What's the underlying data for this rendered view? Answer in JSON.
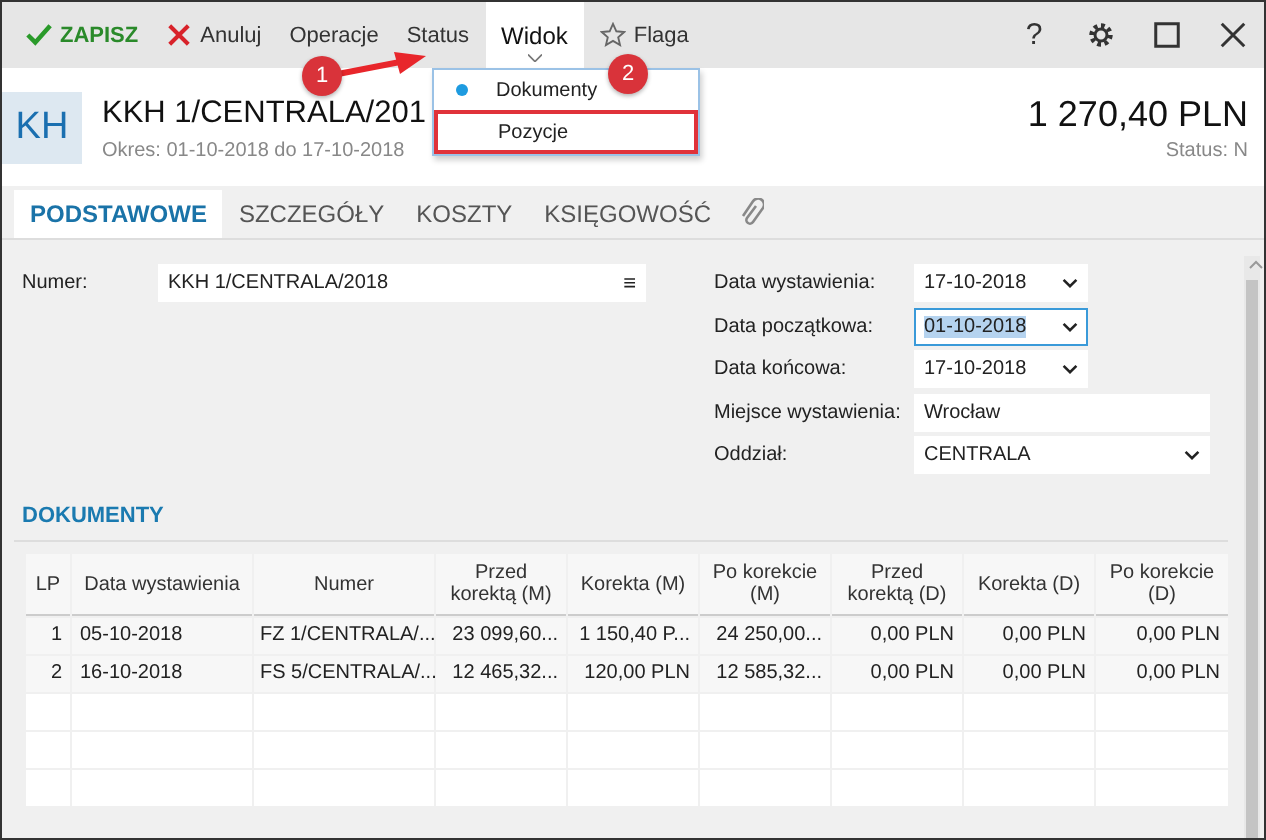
{
  "toolbar": {
    "save": "ZAPISZ",
    "cancel": "Anuluj",
    "menus": [
      {
        "label": "Operacje",
        "selected": false
      },
      {
        "label": "Status",
        "selected": false
      },
      {
        "label": "Widok",
        "selected": true
      }
    ],
    "flag": "Flaga",
    "help": "?"
  },
  "view_menu": {
    "items": [
      {
        "label": "Dokumenty",
        "selected": true,
        "highlighted": false
      },
      {
        "label": "Pozycje",
        "selected": false,
        "highlighted": true
      }
    ]
  },
  "callouts": [
    "1",
    "2"
  ],
  "header": {
    "avatar": "KH",
    "title": "KKH 1/CENTRALA/201",
    "period": "Okres: 01-10-2018 do 17-10-2018",
    "amount": "1 270,40 PLN",
    "status": "Status: N"
  },
  "tabs": [
    {
      "label": "PODSTAWOWE",
      "selected": true
    },
    {
      "label": "SZCZEGÓŁY",
      "selected": false
    },
    {
      "label": "KOSZTY",
      "selected": false
    },
    {
      "label": "KSIĘGOWOŚĆ",
      "selected": false
    }
  ],
  "numer": {
    "label": "Numer:",
    "value": "KKH 1/CENTRALA/2018",
    "menu": "≡"
  },
  "fields": [
    {
      "label": "Data wystawienia:",
      "value": "17-10-2018",
      "kind": "date",
      "focused": false
    },
    {
      "label": "Data początkowa:",
      "value": "01-10-2018",
      "kind": "date",
      "focused": true
    },
    {
      "label": "Data końcowa:",
      "value": "17-10-2018",
      "kind": "date",
      "focused": false
    },
    {
      "label": "Miejsce wystawienia:",
      "value": "Wrocław",
      "kind": "text",
      "focused": false
    },
    {
      "label": "Oddział:",
      "value": "CENTRALA",
      "kind": "select",
      "focused": false
    }
  ],
  "section_title": "DOKUMENTY",
  "table": {
    "columns": [
      "LP",
      "Data wystawienia",
      "Numer",
      "Przed korektą (M)",
      "Korekta (M)",
      "Po korekcie (M)",
      "Przed korektą (D)",
      "Korekta (D)",
      "Po korekcie (D)"
    ],
    "rows": [
      [
        "1",
        "05-10-2018",
        "FZ 1/CENTRALA/...",
        "23 099,60...",
        "1 150,40 P...",
        "24 250,00...",
        "0,00 PLN",
        "0,00 PLN",
        "0,00 PLN"
      ],
      [
        "2",
        "16-10-2018",
        "FS 5/CENTRALA/...",
        "12 465,32...",
        "120,00 PLN",
        "12 585,32...",
        "0,00 PLN",
        "0,00 PLN",
        "0,00 PLN"
      ]
    ]
  }
}
